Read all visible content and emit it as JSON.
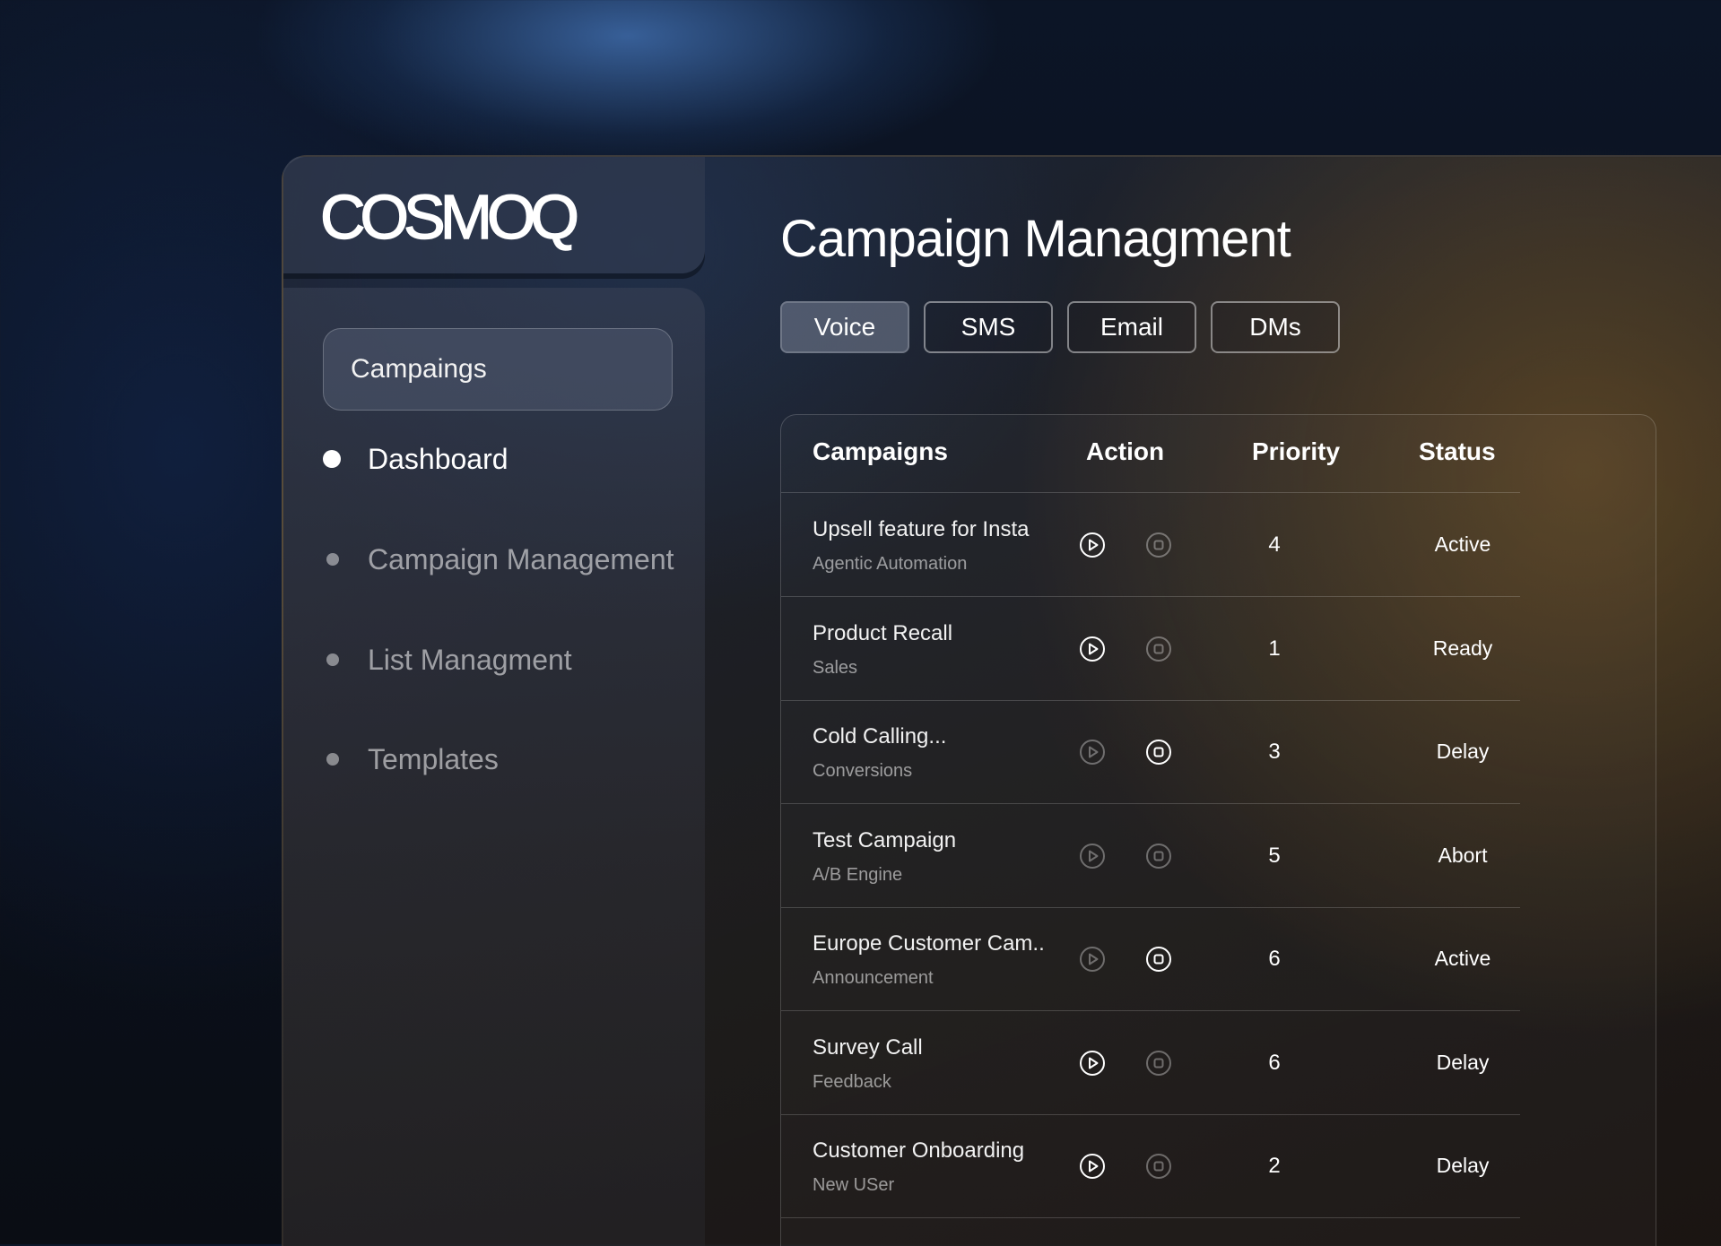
{
  "brand": {
    "logo_text": "COSMOQ"
  },
  "sidebar": {
    "campaigns_button": "Campaings",
    "items": [
      {
        "label": "Dashboard",
        "active": true
      },
      {
        "label": "Campaign Management",
        "active": false
      },
      {
        "label": "List Managment",
        "active": false
      },
      {
        "label": "Templates",
        "active": false
      }
    ]
  },
  "main": {
    "title": "Campaign Managment",
    "tabs": [
      {
        "label": "Voice",
        "active": true
      },
      {
        "label": "SMS",
        "active": false
      },
      {
        "label": "Email",
        "active": false
      },
      {
        "label": "DMs",
        "active": false
      }
    ]
  },
  "table": {
    "headers": {
      "campaigns": "Campaigns",
      "action": "Action",
      "priority": "Priority",
      "status": "Status"
    },
    "rows": [
      {
        "name": "Upsell feature for Insta",
        "subtitle": "Agentic Automation",
        "play_active": true,
        "stop_active": false,
        "priority": "4",
        "status": "Active"
      },
      {
        "name": "Product Recall",
        "subtitle": "Sales",
        "play_active": true,
        "stop_active": false,
        "priority": "1",
        "status": "Ready"
      },
      {
        "name": "Cold Calling...",
        "subtitle": "Conversions",
        "play_active": false,
        "stop_active": true,
        "priority": "3",
        "status": "Delay"
      },
      {
        "name": "Test Campaign",
        "subtitle": "A/B Engine",
        "play_active": false,
        "stop_active": false,
        "priority": "5",
        "status": "Abort"
      },
      {
        "name": "Europe Customer Cam..",
        "subtitle": "Announcement",
        "play_active": false,
        "stop_active": true,
        "priority": "6",
        "status": "Active"
      },
      {
        "name": "Survey Call",
        "subtitle": "Feedback",
        "play_active": true,
        "stop_active": false,
        "priority": "6",
        "status": "Delay"
      },
      {
        "name": "Customer Onboarding",
        "subtitle": "New USer",
        "play_active": true,
        "stop_active": false,
        "priority": "2",
        "status": "Delay"
      }
    ]
  },
  "icons": {
    "play": "play-circle-icon",
    "stop": "stop-circle-icon"
  }
}
